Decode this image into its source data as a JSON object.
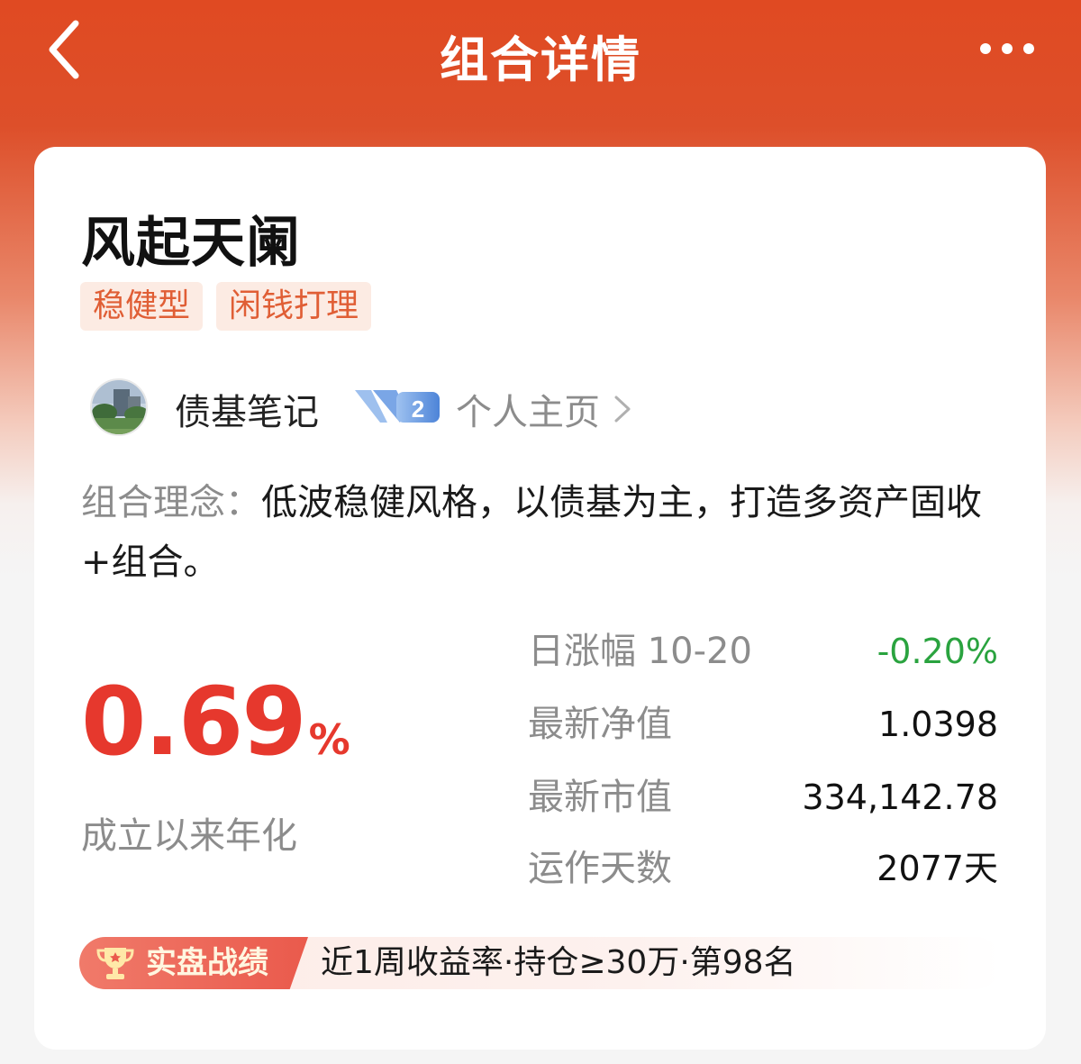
{
  "header": {
    "title": "组合详情"
  },
  "portfolio": {
    "name": "风起天阑",
    "tags": [
      "稳健型",
      "闲钱打理"
    ],
    "author": {
      "name": "债基笔记",
      "level": "2",
      "homepage_label": "个人主页"
    },
    "concept": {
      "label": "组合理念：",
      "text": "低波稳健风格，以债基为主，打造多资产固收+组合。"
    },
    "annualized": {
      "value": "0.69",
      "unit": "%",
      "label": "成立以来年化"
    },
    "stats": [
      {
        "label": "日涨幅 10-20",
        "value": "-0.20%"
      },
      {
        "label": "最新净值",
        "value": "1.0398"
      },
      {
        "label": "最新市值",
        "value": "334,142.78"
      },
      {
        "label": "运作天数",
        "value": "2077天"
      }
    ],
    "record": {
      "title": "实盘战绩",
      "text": "近1周收益率·持仓≥30万·第98名"
    }
  },
  "colors": {
    "header": "#e04a22",
    "tag_text": "#e05e35",
    "tag_bg": "#fcebe3",
    "positive": "#e6382d",
    "negative": "#2aa33f"
  },
  "icons": {
    "back": "chevron-left-icon",
    "more": "more-dots-icon",
    "arrow": "chevron-right-icon",
    "trophy": "trophy-icon",
    "level_badge": "v-level-badge-icon"
  }
}
